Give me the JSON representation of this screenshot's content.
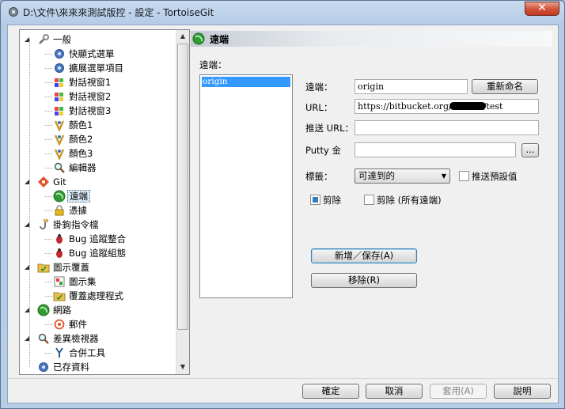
{
  "window": {
    "title": "D:\\文件\\來來來測試版控 - 設定 - TortoiseGit",
    "close_symbol": "✕"
  },
  "tree": {
    "items": [
      {
        "label": "一般",
        "icon": "wrench-icon"
      },
      {
        "label": "快顯式選單",
        "icon": "gear-icon"
      },
      {
        "label": "擴展選單項目",
        "icon": "gear-icon"
      },
      {
        "label": "對話視窗1",
        "icon": "windows-flag-icon"
      },
      {
        "label": "對話視窗2",
        "icon": "windows-flag-icon"
      },
      {
        "label": "對話視窗3",
        "icon": "windows-flag-icon"
      },
      {
        "label": "顏色1",
        "icon": "palette-icon"
      },
      {
        "label": "顏色2",
        "icon": "palette-icon"
      },
      {
        "label": "顏色3",
        "icon": "palette-icon"
      },
      {
        "label": "編輯器",
        "icon": "magnifier-icon"
      },
      {
        "label": "Git",
        "icon": "git-icon"
      },
      {
        "label": "遠端",
        "icon": "globe-icon"
      },
      {
        "label": "憑據",
        "icon": "lock-icon"
      },
      {
        "label": "掛鉤指令檔",
        "icon": "hook-icon"
      },
      {
        "label": "Bug 追蹤整合",
        "icon": "bug-icon"
      },
      {
        "label": "Bug 追蹤組態",
        "icon": "bug-icon"
      },
      {
        "label": "圖示覆蓋",
        "icon": "folder-icon"
      },
      {
        "label": "圖示集",
        "icon": "iconset-icon"
      },
      {
        "label": "覆蓋處理程式",
        "icon": "folder-icon"
      },
      {
        "label": "網路",
        "icon": "globe-icon"
      },
      {
        "label": "郵件",
        "icon": "email-icon"
      },
      {
        "label": "差異檢視器",
        "icon": "magnifier-icon"
      },
      {
        "label": "合併工具",
        "icon": "merge-icon"
      },
      {
        "label": "已存資料",
        "icon": "gear-icon"
      }
    ]
  },
  "panel": {
    "header": "遠端",
    "remote_list_label": "遠端：",
    "remote_list": [
      "origin"
    ],
    "remote_label": "遠端：",
    "remote_value": "origin",
    "rename_button": "重新命名",
    "url_label": "URL：",
    "url_prefix": "https://bitbucket.org/",
    "url_suffix": "/test",
    "push_url_label": "推送 URL：",
    "push_url_value": "",
    "putty_label": "Putty 金",
    "putty_value": "",
    "browse_button": "...",
    "tags_label": "標籤：",
    "tags_value": "可達到的",
    "push_default_label": "推送預設值",
    "prune_label": "剪除",
    "prune_all_label": "剪除 (所有遠端)",
    "add_save_button": "新增／保存(A)",
    "remove_button": "移除(R)"
  },
  "footer": {
    "ok": "確定",
    "cancel": "取消",
    "apply": "套用(A)",
    "help": "說明"
  },
  "colors": {
    "selection": "#3399ff",
    "title_bar": "#b9cde5",
    "close_button": "#c7452c"
  }
}
